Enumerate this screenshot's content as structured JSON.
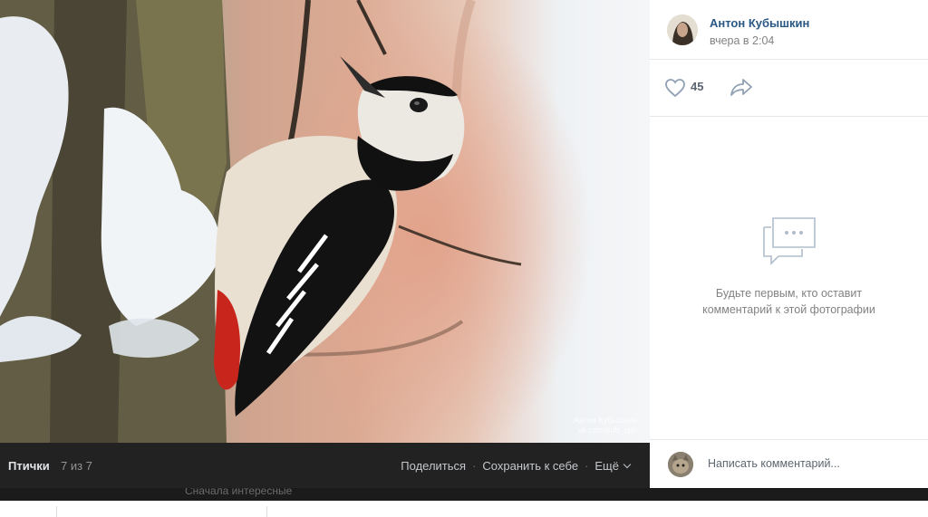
{
  "photo": {
    "watermark_line1": "Антон Кубышкин",
    "watermark_line2": "vk.com/kub_sph"
  },
  "photo_bar": {
    "album": "Птички",
    "counter": "7 из 7",
    "share_label": "Поделиться",
    "save_label": "Сохранить к себе",
    "more_label": "Ещё"
  },
  "author": {
    "name": "Антон Кубышкин",
    "date": "вчера в 2:04"
  },
  "reactions": {
    "likes": "45"
  },
  "comments": {
    "empty_line1": "Будьте первым, кто оставит",
    "empty_line2": "комментарий к этой фотографии",
    "placeholder": "Написать комментарий..."
  },
  "background_page": {
    "ghost_text": "Сначала интересные"
  },
  "colors": {
    "link": "#2a5885",
    "photo_bar": "#222222",
    "muted": "#828282"
  },
  "icons": [
    "heart-icon",
    "share-arrow-icon",
    "comment-bubbles-icon",
    "chevron-down-icon"
  ]
}
